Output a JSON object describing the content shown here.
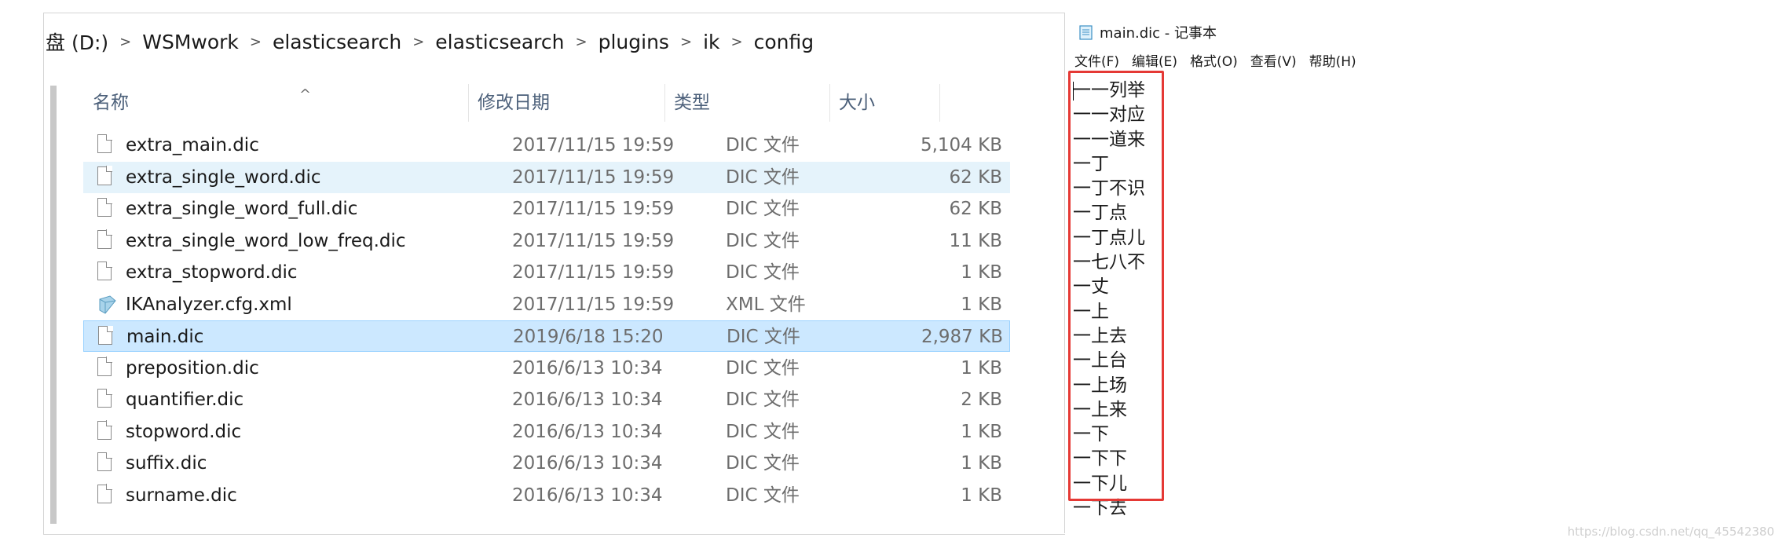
{
  "explorer": {
    "breadcrumb": [
      "盘 (D:)",
      "WSMwork",
      "elasticsearch",
      "elasticsearch",
      "plugins",
      "ik",
      "config"
    ],
    "columns": {
      "name": "名称",
      "date": "修改日期",
      "type": "类型",
      "size": "大小"
    },
    "files": [
      {
        "name": "extra_main.dic",
        "date": "2017/11/15 19:59",
        "type": "DIC 文件",
        "size": "5,104 KB",
        "icon": "file-icon",
        "state": "normal"
      },
      {
        "name": "extra_single_word.dic",
        "date": "2017/11/15 19:59",
        "type": "DIC 文件",
        "size": "62 KB",
        "icon": "file-icon",
        "state": "hover"
      },
      {
        "name": "extra_single_word_full.dic",
        "date": "2017/11/15 19:59",
        "type": "DIC 文件",
        "size": "62 KB",
        "icon": "file-icon",
        "state": "normal"
      },
      {
        "name": "extra_single_word_low_freq.dic",
        "date": "2017/11/15 19:59",
        "type": "DIC 文件",
        "size": "11 KB",
        "icon": "file-icon",
        "state": "normal"
      },
      {
        "name": "extra_stopword.dic",
        "date": "2017/11/15 19:59",
        "type": "DIC 文件",
        "size": "1 KB",
        "icon": "file-icon",
        "state": "normal"
      },
      {
        "name": "IKAnalyzer.cfg.xml",
        "date": "2017/11/15 19:59",
        "type": "XML 文件",
        "size": "1 KB",
        "icon": "xml-file-icon",
        "state": "normal"
      },
      {
        "name": "main.dic",
        "date": "2019/6/18 15:20",
        "type": "DIC 文件",
        "size": "2,987 KB",
        "icon": "file-icon",
        "state": "selected"
      },
      {
        "name": "preposition.dic",
        "date": "2016/6/13 10:34",
        "type": "DIC 文件",
        "size": "1 KB",
        "icon": "file-icon",
        "state": "normal"
      },
      {
        "name": "quantifier.dic",
        "date": "2016/6/13 10:34",
        "type": "DIC 文件",
        "size": "2 KB",
        "icon": "file-icon",
        "state": "normal"
      },
      {
        "name": "stopword.dic",
        "date": "2016/6/13 10:34",
        "type": "DIC 文件",
        "size": "1 KB",
        "icon": "file-icon",
        "state": "normal"
      },
      {
        "name": "suffix.dic",
        "date": "2016/6/13 10:34",
        "type": "DIC 文件",
        "size": "1 KB",
        "icon": "file-icon",
        "state": "normal"
      },
      {
        "name": "surname.dic",
        "date": "2016/6/13 10:34",
        "type": "DIC 文件",
        "size": "1 KB",
        "icon": "file-icon",
        "state": "normal"
      }
    ]
  },
  "notepad": {
    "title": "main.dic - 记事本",
    "menu": [
      "文件(F)",
      "编辑(E)",
      "格式(O)",
      "查看(V)",
      "帮助(H)"
    ],
    "lines": [
      "一一列举",
      "一一对应",
      "一一道来",
      "一丁",
      "一丁不识",
      "一丁点",
      "一丁点儿",
      "一七八不",
      "一丈",
      "一上",
      "一上去",
      "一上台",
      "一上场",
      "一上来",
      "一下",
      "一下下",
      "一下儿",
      "一下去"
    ]
  },
  "colors": {
    "highlight_border": "#e53935",
    "selected_row": "#cce8ff",
    "hover_row": "#e5f3fb",
    "header_text": "#4c607a"
  },
  "watermark": "https://blog.csdn.net/qq_45542380"
}
